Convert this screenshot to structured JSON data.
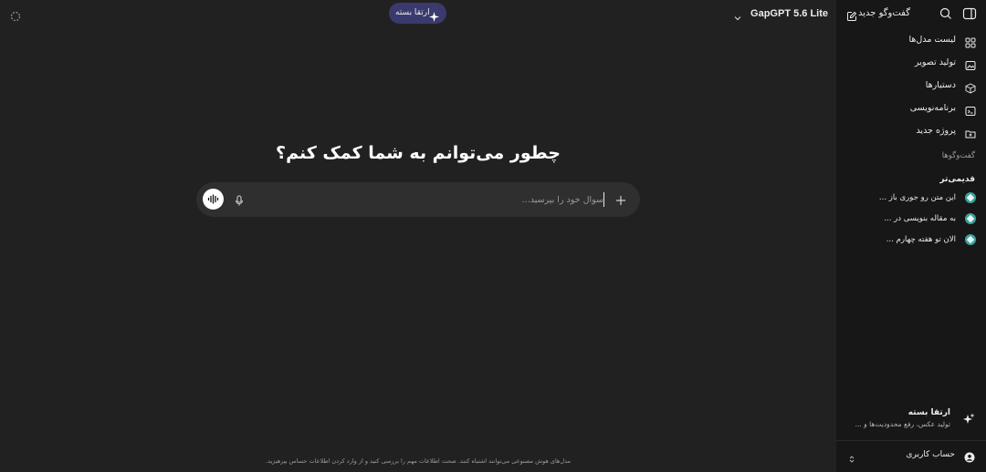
{
  "header": {
    "model_name": "GapGPT 5.6 Lite",
    "upgrade_pill_label": "ارتقا بسته"
  },
  "sidebar": {
    "new_chat_label": "گفت‌وگو جدید",
    "nav_items": [
      {
        "label": "لیست مدل‌ها",
        "icon": "grid-icon"
      },
      {
        "label": "تولید تصویر",
        "icon": "image-icon"
      },
      {
        "label": "دستیارها",
        "icon": "cube-icon"
      },
      {
        "label": "برنامه‌نویسی",
        "icon": "code-icon"
      },
      {
        "label": "پروژه جدید",
        "icon": "folder-plus-icon"
      }
    ],
    "conversations_heading": "گفت‌وگوها",
    "older_heading": "قدیمی‌تر",
    "conversations": [
      {
        "title": "این متن رو جوری باز ..."
      },
      {
        "title": "به مقاله بنویسی در ..."
      },
      {
        "title": "الان تو هفته چهارم ..."
      }
    ],
    "upgrade": {
      "title": "ارتقا بسته",
      "subtitle": "تولید عکس، رفع محدودیت‌ها و ..."
    },
    "account_label": "حساب کاربری"
  },
  "main": {
    "headline": "چطور می‌توانم به شما کمک کنم؟",
    "input_placeholder": "سوال خود را بپرسید...",
    "disclaimer": "مدل‌های هوش مصنوعی می‌توانند اشتباه کنند. صحت اطلاعات مهم را بررسی کنید و از وارد کردن اطلاعات حساس بپرهیزید."
  },
  "colors": {
    "background": "#212121",
    "sidebar": "#171717",
    "composer": "#2f2f2f",
    "upgrade_pill": "#3b3a6e",
    "conversation_icon": "#3aa39a"
  }
}
